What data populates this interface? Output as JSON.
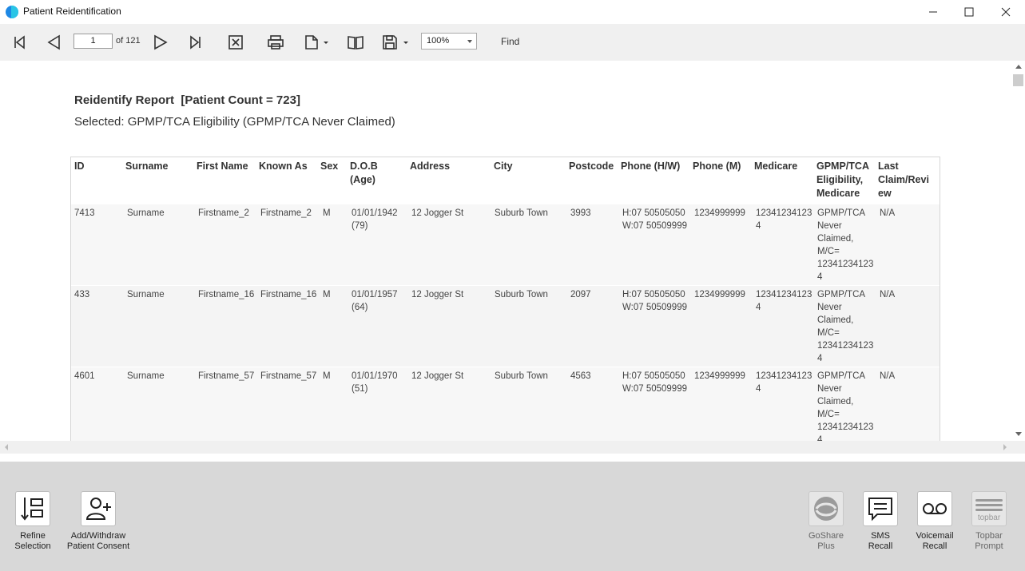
{
  "window": {
    "title": "Patient Reidentification"
  },
  "toolbar": {
    "page_current": "1",
    "page_of": "of 121",
    "zoom": "100%",
    "find_label": "Find"
  },
  "report": {
    "title": "Reidentify Report  [Patient Count = 723]",
    "subtitle": "Selected: GPMP/TCA Eligibility (GPMP/TCA Never Claimed)",
    "columns": [
      "ID",
      "Surname",
      "First Name",
      "Known As",
      "Sex",
      "D.O.B\n(Age)",
      "Address",
      "City",
      "Postcode",
      "Phone (H/W)",
      "Phone (M)",
      "Medicare",
      "GPMP/TCA\nEligibility,\nMedicare",
      "Last\nClaim/Revi\new"
    ],
    "rows": [
      {
        "id": "7413",
        "surname": "Surname",
        "first_name": "Firstname_2",
        "known_as": "Firstname_2",
        "sex": "M",
        "dob": "01/01/1942\n(79)",
        "address": "12 Jogger St",
        "city": "Suburb Town",
        "postcode": "3993",
        "phone_hw": "H:07 50505050\nW:07 50509999",
        "phone_m": "1234999999",
        "medicare": "12341234123\n4",
        "eligibility": "GPMP/TCA\nNever\nClaimed,\nM/C=\n12341234123\n4",
        "last_claim": "N/A"
      },
      {
        "id": "433",
        "surname": "Surname",
        "first_name": "Firstname_16",
        "known_as": "Firstname_16",
        "sex": "M",
        "dob": "01/01/1957\n(64)",
        "address": "12 Jogger St",
        "city": "Suburb Town",
        "postcode": "2097",
        "phone_hw": "H:07 50505050\nW:07 50509999",
        "phone_m": "1234999999",
        "medicare": "12341234123\n4",
        "eligibility": "GPMP/TCA\nNever\nClaimed,\nM/C=\n12341234123\n4",
        "last_claim": "N/A"
      },
      {
        "id": "4601",
        "surname": "Surname",
        "first_name": "Firstname_57",
        "known_as": "Firstname_57",
        "sex": "M",
        "dob": "01/01/1970\n(51)",
        "address": "12 Jogger St",
        "city": "Suburb Town",
        "postcode": "4563",
        "phone_hw": "H:07 50505050\nW:07 50509999",
        "phone_m": "1234999999",
        "medicare": "12341234123\n4",
        "eligibility": "GPMP/TCA\nNever\nClaimed,\nM/C=\n12341234123\n4",
        "last_claim": "N/A"
      }
    ]
  },
  "actions": {
    "refine": "Refine\nSelection",
    "consent": "Add/Withdraw\nPatient Consent",
    "goshare": "GoShare\nPlus",
    "sms": "SMS\nRecall",
    "voicemail": "Voicemail\nRecall",
    "topbar": "Topbar\nPrompt",
    "topbar_logo_text": "topbar"
  }
}
